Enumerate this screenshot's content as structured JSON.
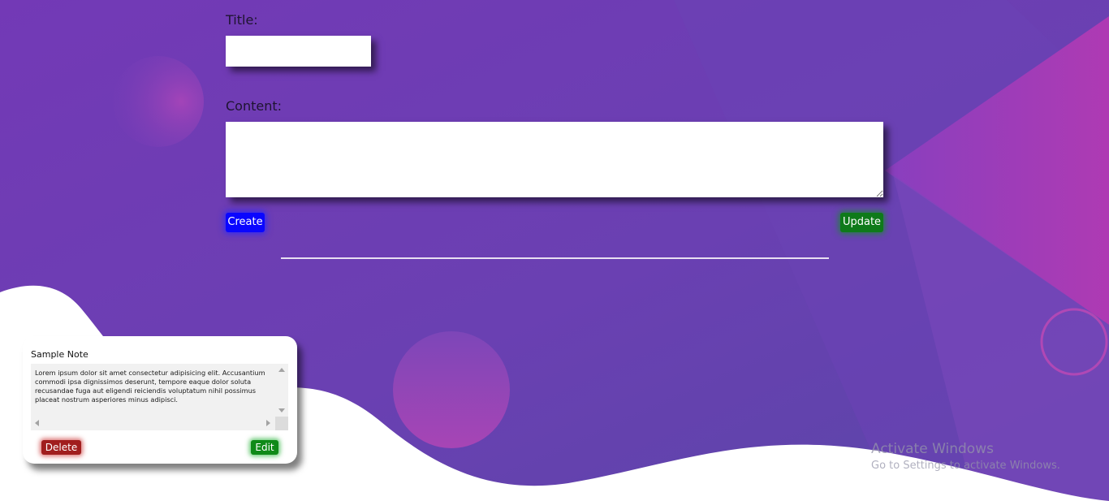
{
  "form": {
    "title_label": "Title:",
    "title_value": "",
    "content_label": "Content:",
    "content_value": "",
    "create_label": "Create",
    "update_label": "Update"
  },
  "notes": [
    {
      "title": "Sample Note",
      "content": "Lorem ipsum dolor sit amet consectetur adipisicing elit. Accusantium commodi ipsa dignissimos deserunt, tempore eaque dolor soluta recusandae fuga aut eligendi reiciendis voluptatum nihil possimus placeat nostrum asperiores minus adipisci.",
      "delete_label": "Delete",
      "edit_label": "Edit"
    }
  ],
  "watermark": {
    "title": "Activate Windows",
    "subtitle": "Go to Settings to activate Windows."
  },
  "colors": {
    "background_purple": "#6a3db5",
    "accent_pink": "#b13ab2",
    "create_button": "#0a06ff",
    "update_button": "#0e7a1a",
    "delete_button": "#a11e1e",
    "edit_button": "#0f8a18"
  }
}
